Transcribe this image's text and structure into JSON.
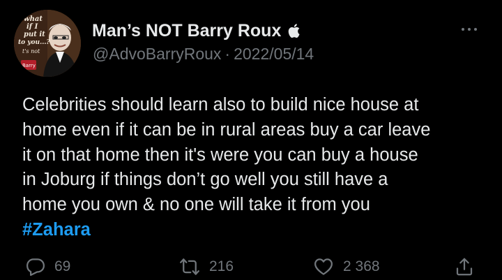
{
  "tweet": {
    "avatar_text": [
      "what",
      "if I",
      "put it",
      "to you...?",
      "t's not",
      "Barry"
    ],
    "display_name": "Man’s NOT Barry Roux",
    "verified_icon": "apple-icon",
    "handle": "@AdvoBarryRoux",
    "separator": "·",
    "date": "2022/05/14",
    "more_icon": "more-dots-icon",
    "text_lines": [
      "Celebrities should learn also to build nice house at",
      "home even if it can be in rural areas buy a car leave",
      "it on that home then it's were you can buy a house",
      "in Joburg if things don’t go well you still have a",
      "home you own & no one will take it from you"
    ],
    "hashtag": "#Zahara",
    "actions": {
      "reply_count": "69",
      "retweet_count": "216",
      "like_count": "2 368"
    }
  },
  "colors": {
    "background": "#000000",
    "text": "#e7e9ea",
    "secondary": "#71767b",
    "accent": "#1d9bf0"
  }
}
